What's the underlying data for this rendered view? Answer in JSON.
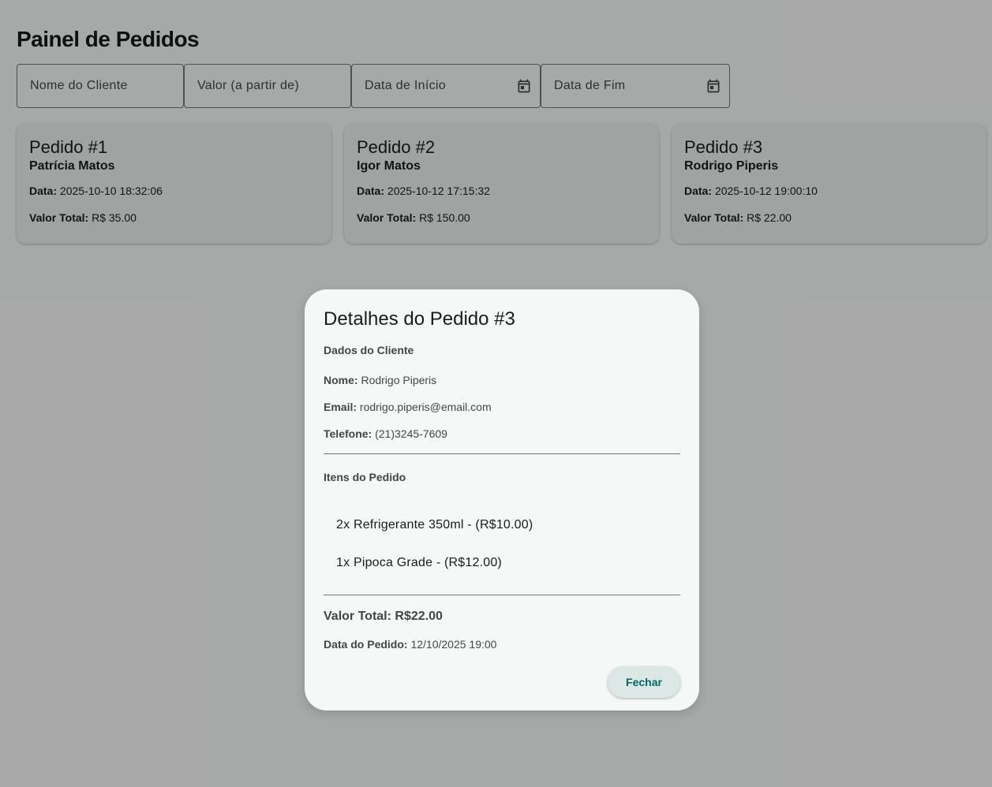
{
  "header": {
    "title": "Painel de Pedidos"
  },
  "filters": {
    "client_placeholder": "Nome do Cliente",
    "value_placeholder": "Valor (a partir de)",
    "start_date_placeholder": "Data de Início",
    "end_date_placeholder": "Data de Fim",
    "calendar_icon": "calendar-icon"
  },
  "orders": [
    {
      "title": "Pedido #1",
      "client": "Patrícia Matos",
      "date_label": "Data:",
      "date": "2025-10-10 18:32:06",
      "total_label": "Valor Total:",
      "total": "R$ 35.00"
    },
    {
      "title": "Pedido #2",
      "client": "Igor Matos",
      "date_label": "Data:",
      "date": "2025-10-12 17:15:32",
      "total_label": "Valor Total:",
      "total": "R$ 150.00"
    },
    {
      "title": "Pedido #3",
      "client": "Rodrigo Piperis",
      "date_label": "Data:",
      "date": "2025-10-12 19:00:10",
      "total_label": "Valor Total:",
      "total": "R$ 22.00"
    }
  ],
  "dialog": {
    "title": "Detalhes do Pedido #3",
    "client_section": "Dados do Cliente",
    "name_label": "Nome:",
    "name": "Rodrigo Piperis",
    "email_label": "Email:",
    "email": "rodrigo.piperis@email.com",
    "phone_label": "Telefone:",
    "phone": "(21)3245-7609",
    "items_section": "Itens do Pedido",
    "items": [
      "2x Refrigerante 350ml - (R$10.00)",
      "1x Pipoca Grade - (R$12.00)"
    ],
    "total": "Valor Total: R$22.00",
    "order_date_label": "Data do Pedido:",
    "order_date": "12/10/2025 19:00",
    "close_label": "Fechar"
  },
  "colors": {
    "accent": "#00696a",
    "button_bg": "#dbe8e6",
    "dialog_bg": "#f4f8f7",
    "scrim": "rgba(0,0,0,0.32)"
  }
}
